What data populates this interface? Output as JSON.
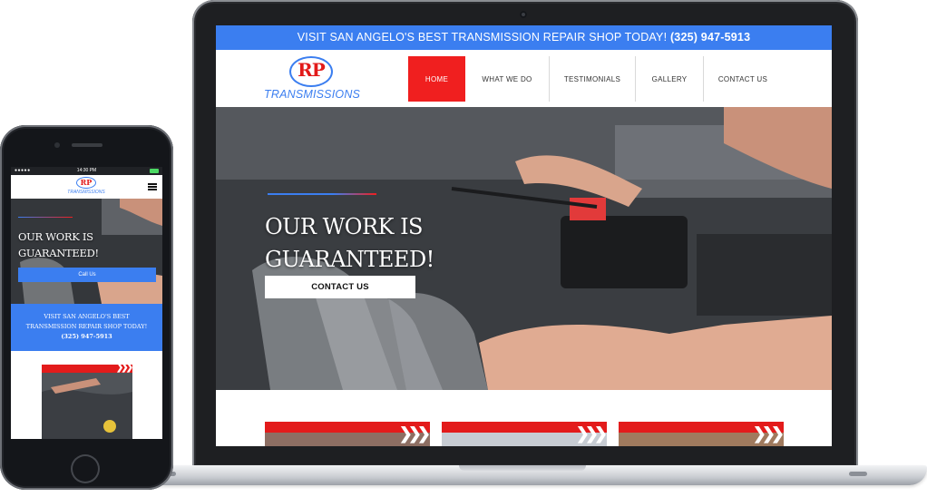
{
  "laptop_site": {
    "topbar": {
      "text": "VISIT SAN ANGELO'S BEST TRANSMISSION REPAIR SHOP TODAY! ",
      "phone": "(325) 947-5913"
    },
    "logo": {
      "mark": "RP",
      "wordmark": "TRANSMISSIONS"
    },
    "nav": [
      "HOME",
      "WHAT WE DO",
      "TESTIMONIALS",
      "GALLERY",
      "CONTACT US"
    ],
    "hero": {
      "title_line1": "OUR WORK IS",
      "title_line2": "GUARANTEED!",
      "button": "CONTACT US"
    }
  },
  "phone_site": {
    "status_time": "14:30 PM",
    "logo": {
      "mark": "RP",
      "wordmark": "TRANSMISSIONS"
    },
    "hero": {
      "title_line1": "OUR WORK IS",
      "title_line2": "GUARANTEED!",
      "button": "Call Us"
    },
    "cta": {
      "line1": "VISIT SAN ANGELO'S BEST",
      "line2": "TRANSMISSION REPAIR SHOP TODAY!",
      "phone": "(325) 947-5913"
    }
  },
  "colors": {
    "brand_blue": "#3b7ef0",
    "brand_red": "#f01f1f"
  }
}
